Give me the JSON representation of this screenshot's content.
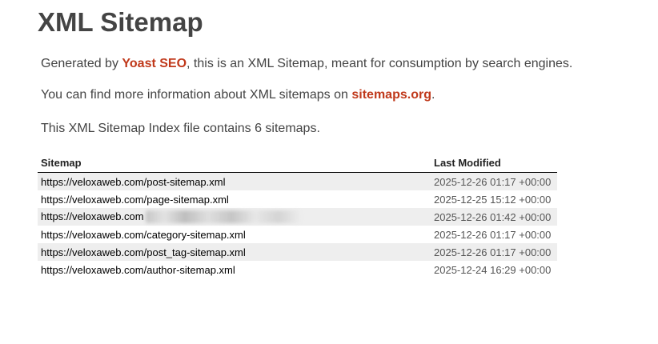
{
  "header": {
    "title": "XML Sitemap"
  },
  "intro": {
    "generated_prefix": "Generated by ",
    "generated_link": "Yoast SEO",
    "generated_suffix": ", this is an XML Sitemap, meant for consumption by search engines.",
    "info_prefix": "You can find more information about XML sitemaps on ",
    "info_link": "sitemaps.org",
    "info_suffix": ".",
    "count_text": "This XML Sitemap Index file contains 6 sitemaps."
  },
  "colors": {
    "link": "#c0391b",
    "text": "#444444",
    "row_stripe": "#eeeeee"
  },
  "table": {
    "headers": {
      "sitemap": "Sitemap",
      "last_modified": "Last Modified"
    },
    "rows": [
      {
        "url": "https://veloxaweb.com/post-sitemap.xml",
        "modified": "2025-12-26 01:17 +00:00"
      },
      {
        "url": "https://veloxaweb.com/page-sitemap.xml",
        "modified": "2025-12-25 15:12 +00:00"
      },
      {
        "url": "https://veloxaweb.com",
        "modified": "2025-12-26 01:42 +00:00",
        "redacted": true
      },
      {
        "url": "https://veloxaweb.com/category-sitemap.xml",
        "modified": "2025-12-26 01:17 +00:00"
      },
      {
        "url": "https://veloxaweb.com/post_tag-sitemap.xml",
        "modified": "2025-12-26 01:17 +00:00"
      },
      {
        "url": "https://veloxaweb.com/author-sitemap.xml",
        "modified": "2025-12-24 16:29 +00:00"
      }
    ]
  }
}
